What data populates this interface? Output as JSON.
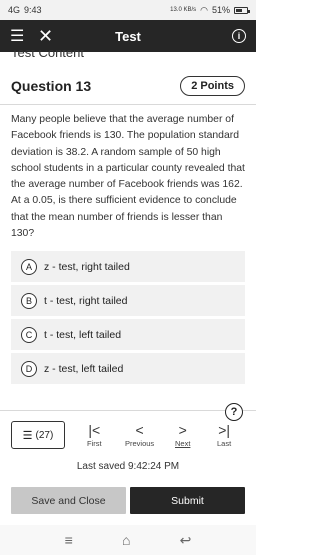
{
  "status_bar": {
    "network": "4G",
    "time": "9:43",
    "speed": "13.0 KB/s",
    "battery": "51%"
  },
  "app_bar": {
    "title": "Test"
  },
  "section_peek": "Test Content",
  "question": {
    "title": "Question 13",
    "points": "2 Points",
    "text": "Many people believe that the average number of Facebook friends is 130. The population standard deviation is 38.2. A random sample of 50 high school students in a particular county revealed that the average number of Facebook friends was 162. At a 0.05, is there sufficient evidence to conclude that the mean number of friends is lesser than 130?"
  },
  "answers": [
    {
      "letter": "A",
      "text": "z - test, right tailed"
    },
    {
      "letter": "B",
      "text": "t - test, right tailed"
    },
    {
      "letter": "C",
      "text": "t - test, left tailed"
    },
    {
      "letter": "D",
      "text": "z - test, left tailed"
    }
  ],
  "navigation": {
    "count": "(27)",
    "first": "First",
    "previous": "Previous",
    "next": "Next",
    "last": "Last"
  },
  "last_saved": "Last saved 9:42:24 PM",
  "footer": {
    "save_close": "Save and Close",
    "submit": "Submit"
  }
}
